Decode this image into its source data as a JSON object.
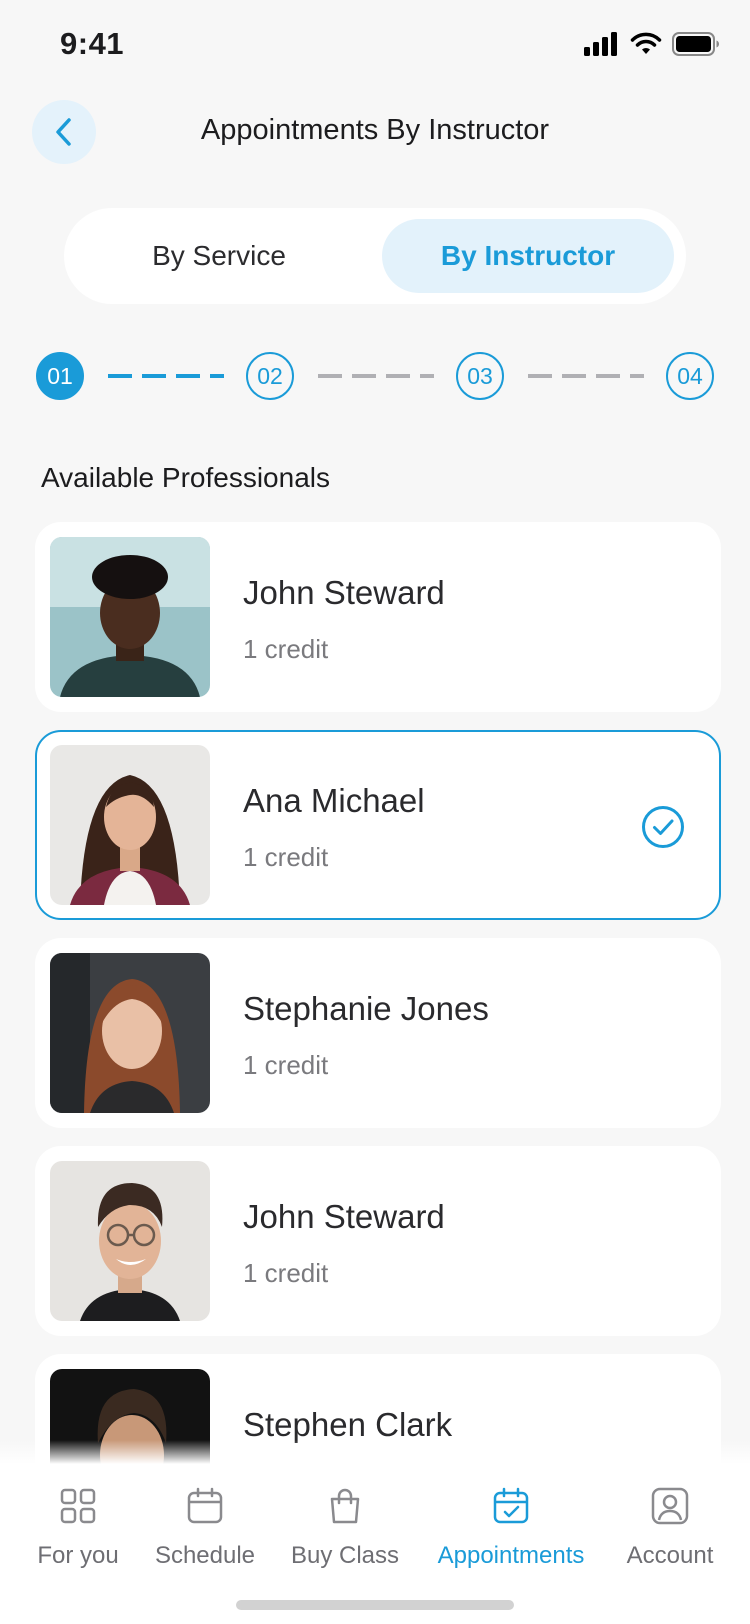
{
  "status_bar": {
    "time": "9:41"
  },
  "header": {
    "title": "Appointments By Instructor",
    "back_icon": "chevron-left-icon"
  },
  "segments": {
    "by_service": "By Service",
    "by_instructor": "By Instructor",
    "active": "by_instructor"
  },
  "stepper": {
    "steps": [
      "01",
      "02",
      "03",
      "04"
    ],
    "current": 1
  },
  "section_title": "Available Professionals",
  "professionals": [
    {
      "name": "John Steward",
      "credit": "1 credit",
      "selected": false
    },
    {
      "name": "Ana Michael",
      "credit": "1 credit",
      "selected": true
    },
    {
      "name": "Stephanie Jones",
      "credit": "1 credit",
      "selected": false
    },
    {
      "name": "John Steward",
      "credit": "1 credit",
      "selected": false
    },
    {
      "name": "Stephen Clark",
      "credit": "",
      "selected": false
    }
  ],
  "nav": {
    "items": [
      {
        "label": "For you",
        "icon": "grid-icon"
      },
      {
        "label": "Schedule",
        "icon": "calendar-icon"
      },
      {
        "label": "Buy Class",
        "icon": "shopping-bag-icon"
      },
      {
        "label": "Appointments",
        "icon": "calendar-check-icon"
      },
      {
        "label": "Account",
        "icon": "account-icon"
      }
    ],
    "active": "Appointments"
  },
  "colors": {
    "accent": "#1a9bd8",
    "accent_light": "#e3f2fb",
    "background": "#f7f7f7",
    "muted": "#7a7a7e"
  }
}
